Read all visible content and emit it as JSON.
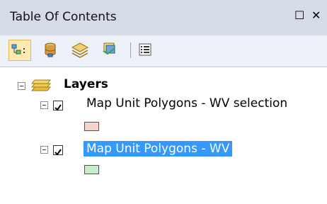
{
  "window": {
    "title": "Table Of Contents",
    "restore_glyph": "☐",
    "close_glyph": "✕"
  },
  "toolbar": {
    "tools": [
      {
        "name": "list-by-drawing-order",
        "active": true
      },
      {
        "name": "list-by-source",
        "active": false
      },
      {
        "name": "list-by-visibility",
        "active": false
      },
      {
        "name": "list-by-selection",
        "active": false
      },
      {
        "name": "options",
        "active": false
      }
    ]
  },
  "toc": {
    "group": {
      "label": "Layers",
      "expanded": true
    },
    "layers": [
      {
        "label": "Map Unit Polygons - WV selection",
        "checked": true,
        "selected": false,
        "swatch_color": "#f6d3cb"
      },
      {
        "label": "Map Unit Polygons - WV",
        "checked": true,
        "selected": true,
        "swatch_color": "#c7ecc9"
      }
    ]
  },
  "colors": {
    "selection": "#3399ff",
    "titlebar": "#d6dbe9",
    "toolbar": "#edf0f7"
  }
}
